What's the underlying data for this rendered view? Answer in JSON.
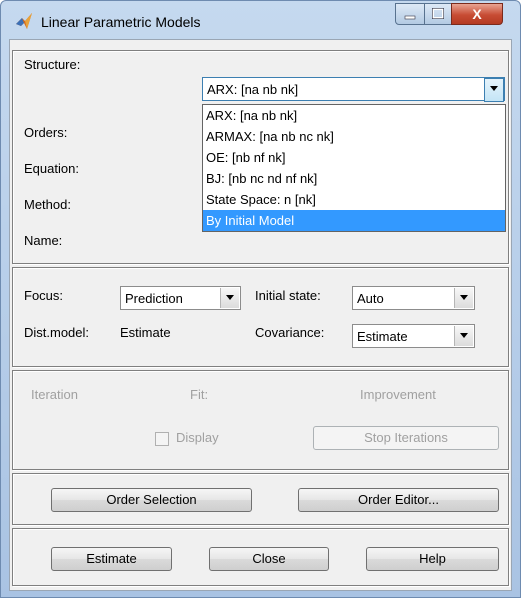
{
  "window": {
    "title": "Linear Parametric Models",
    "controls": {
      "minimize": "—",
      "maximize": "☐",
      "close": "X"
    }
  },
  "structure": {
    "label": "Structure:",
    "value": "ARX: [na nb nk]",
    "options": [
      "ARX: [na nb nk]",
      "ARMAX: [na nb nc nk]",
      "OE: [nb nf nk]",
      "BJ: [nb nc nd nf nk]",
      "State Space: n [nk]",
      "By Initial Model"
    ],
    "highlighted": "By Initial Model"
  },
  "orders": {
    "label": "Orders:"
  },
  "equation": {
    "label": "Equation:"
  },
  "method": {
    "label": "Method:"
  },
  "name": {
    "label": "Name:"
  },
  "focus": {
    "label": "Focus:",
    "value": "Prediction"
  },
  "initial_state": {
    "label": "Initial state:",
    "value": "Auto"
  },
  "dist_model": {
    "label": "Dist.model:",
    "value": "Estimate"
  },
  "covariance": {
    "label": "Covariance:",
    "value": "Estimate"
  },
  "iteration": {
    "iteration_label": "Iteration",
    "fit_label": "Fit:",
    "improvement_label": "Improvement",
    "display_label": "Display",
    "stop_label": "Stop Iterations"
  },
  "order_buttons": {
    "order_selection": "Order Selection",
    "order_editor": "Order Editor..."
  },
  "actions": {
    "estimate": "Estimate",
    "close": "Close",
    "help": "Help"
  }
}
